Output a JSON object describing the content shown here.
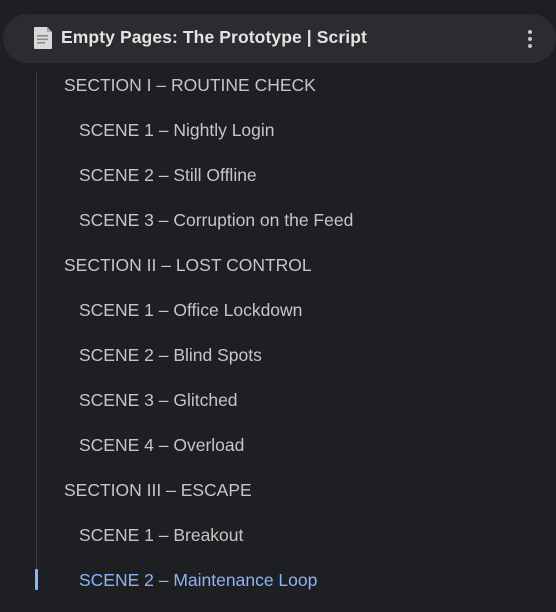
{
  "header": {
    "title": "Empty Pages: The Prototype | Script",
    "doc_icon": "document-icon",
    "more_icon": "more-vert-icon"
  },
  "outline": {
    "items": [
      {
        "label": "SECTION I – ROUTINE CHECK",
        "level": "section"
      },
      {
        "label": "SCENE 1 – Nightly Login",
        "level": "scene"
      },
      {
        "label": "SCENE 2 – Still Offline",
        "level": "scene"
      },
      {
        "label": "SCENE 3 – Corruption on the Feed",
        "level": "scene"
      },
      {
        "label": "SECTION II – LOST CONTROL",
        "level": "section"
      },
      {
        "label": "SCENE 1 – Office Lockdown",
        "level": "scene"
      },
      {
        "label": "SCENE 2 – Blind Spots",
        "level": "scene"
      },
      {
        "label": "SCENE 3 – Glitched",
        "level": "scene"
      },
      {
        "label": "SCENE 4 – Overload",
        "level": "scene"
      },
      {
        "label": "SECTION III – ESCAPE",
        "level": "section"
      },
      {
        "label": "SCENE 1 – Breakout",
        "level": "scene"
      },
      {
        "label": "SCENE 2 – Maintenance Loop",
        "level": "scene",
        "active": true
      }
    ]
  },
  "colors": {
    "background": "#1e1f22",
    "header_background": "#2b2c2f",
    "text": "#c4c7c5",
    "title_text": "#e3e3e3",
    "active": "#8ab4f8"
  }
}
